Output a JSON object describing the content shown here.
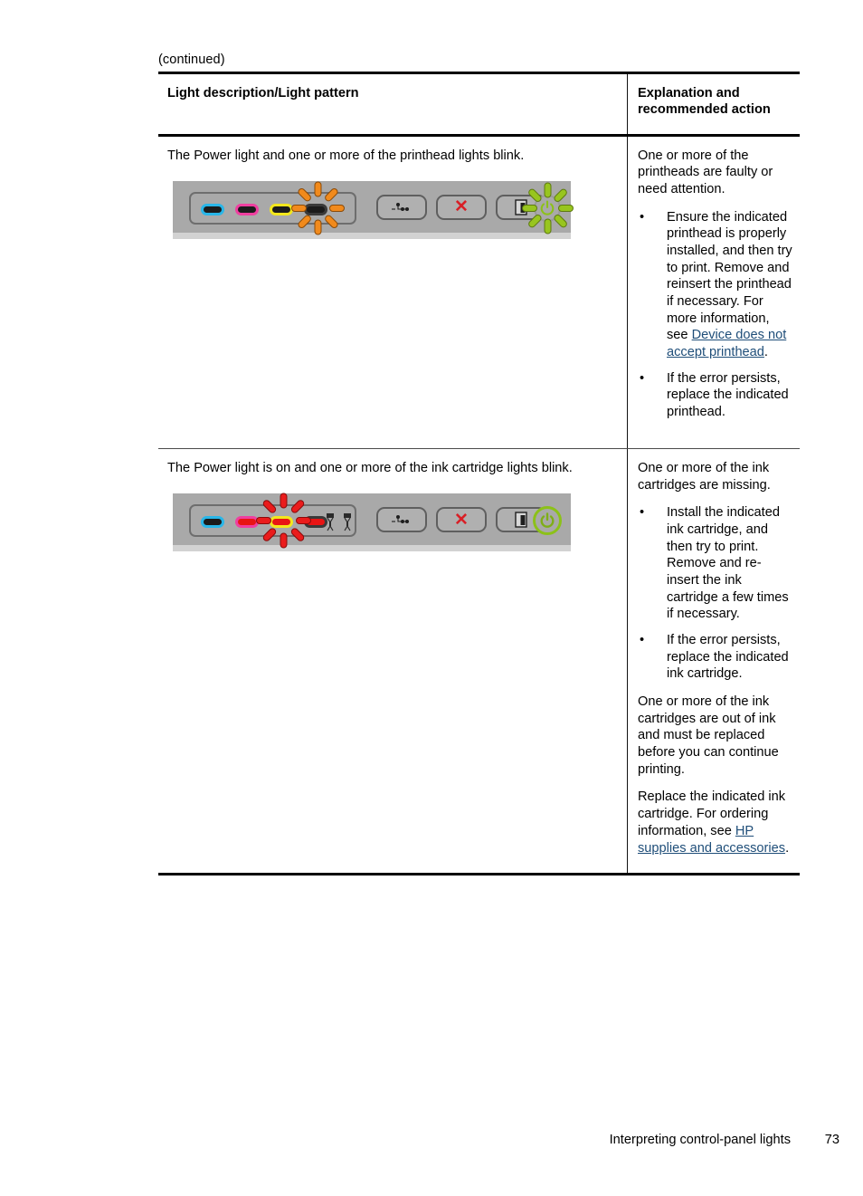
{
  "document": {
    "continued_label": "(continued)",
    "footer": {
      "section_title": "Interpreting control-panel lights",
      "page_number": "73"
    }
  },
  "table": {
    "headers": {
      "left": "Light description/Light pattern",
      "right": "Explanation and\nrecommended action"
    },
    "rows": [
      {
        "description": "The Power light and one or more of the printhead lights blink.",
        "panel": {
          "ink_lamps": [
            {
              "name": "cyan",
              "color": "#29b6e8",
              "state": "off"
            },
            {
              "name": "magenta",
              "color": "#ef3fa0",
              "state": "off"
            },
            {
              "name": "yellow",
              "color": "#f3e71c",
              "state": "off"
            },
            {
              "name": "black",
              "color": "#3a3a3a",
              "state": "blinking-orange"
            }
          ],
          "buttons": [
            "network-button",
            "cancel-button",
            "resume-button"
          ],
          "power_light": "blinking-green"
        },
        "explanation": "One or more of the printheads are faulty or need attention.",
        "actions": [
          {
            "text_before": "Ensure the indicated printhead is properly installed, and then try to print. Remove and reinsert the printhead if necessary. For more information, see ",
            "link": "Device does not accept printhead",
            "text_after": "."
          },
          {
            "text_before": "If the error persists, replace the indicated printhead.",
            "link": "",
            "text_after": ""
          }
        ],
        "extra_paragraphs": []
      },
      {
        "description": "The Power light is on and one or more of the ink cartridge lights blink.",
        "panel": {
          "ink_lamps": [
            {
              "name": "cyan",
              "color": "#29b6e8",
              "state": "off"
            },
            {
              "name": "magenta",
              "color": "#ef3fa0",
              "state": "lit-red"
            },
            {
              "name": "yellow",
              "color": "#f3e71c",
              "state": "blinking-red"
            },
            {
              "name": "black",
              "color": "#3a3a3a",
              "state": "lit-red"
            }
          ],
          "buttons": [
            "network-button",
            "cancel-button",
            "resume-button"
          ],
          "power_light": "solid-green"
        },
        "explanation": "One or more of the ink cartridges are missing.",
        "actions": [
          {
            "text_before": "Install the indicated ink cartridge, and then try to print. Remove and re-insert the ink cartridge a few times if necessary.",
            "link": "",
            "text_after": ""
          },
          {
            "text_before": "If the error persists, replace the indicated ink cartridge.",
            "link": "",
            "text_after": ""
          }
        ],
        "extra_paragraphs": [
          {
            "text_before": "One or more of the ink cartridges are out of ink and must be replaced before you can continue printing.",
            "link": "",
            "text_after": ""
          },
          {
            "text_before": "Replace the indicated ink cartridge. For ordering information, see ",
            "link": "HP supplies and accessories",
            "text_after": "."
          }
        ]
      }
    ]
  },
  "colors": {
    "link": "#1f4e79",
    "panel_bg": "#a9a9a9",
    "ray_orange": "#f18a1c",
    "ray_red": "#ea1c1c",
    "ray_green": "#98c51f",
    "cancel_x": "#d81f26"
  }
}
